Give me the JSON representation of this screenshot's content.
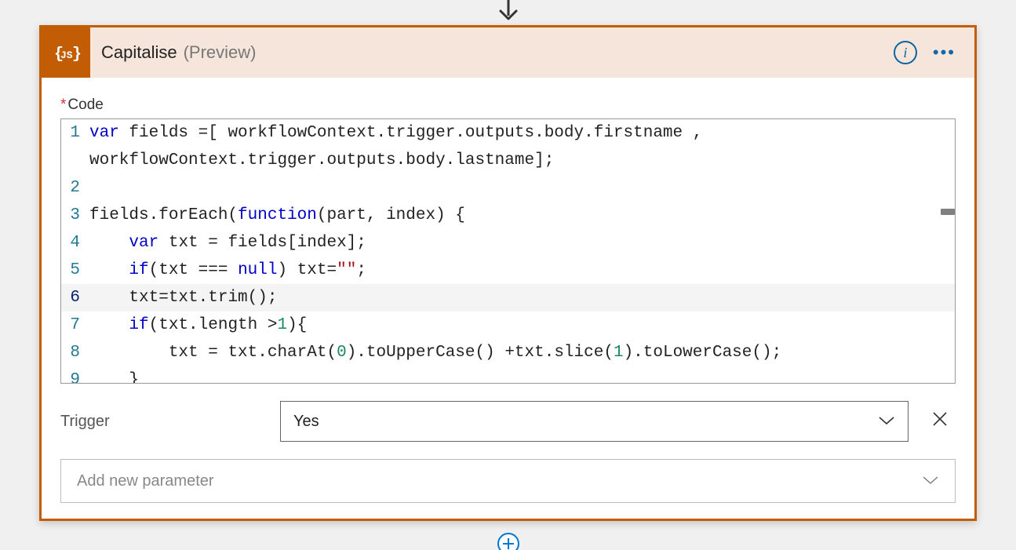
{
  "header": {
    "title": "Capitalise",
    "subtitle": "(Preview)"
  },
  "code": {
    "label": "Code",
    "lines": [
      {
        "n": "1",
        "indent": 0,
        "segs": [
          {
            "t": "var ",
            "c": "kw"
          },
          {
            "t": "fields =[ workflowContext.trigger.outputs.body.firstname ,"
          }
        ]
      },
      {
        "n": "",
        "indent": 0,
        "segs": [
          {
            "t": "workflowContext.trigger.outputs.body.lastname];"
          }
        ]
      },
      {
        "n": "2",
        "indent": 0,
        "segs": []
      },
      {
        "n": "3",
        "indent": 0,
        "segs": [
          {
            "t": "fields.forEach("
          },
          {
            "t": "function",
            "c": "kw"
          },
          {
            "t": "(part, index) {"
          }
        ]
      },
      {
        "n": "4",
        "indent": 1,
        "segs": [
          {
            "t": "var ",
            "c": "kw"
          },
          {
            "t": "txt = fields[index];"
          }
        ]
      },
      {
        "n": "5",
        "indent": 1,
        "segs": [
          {
            "t": "if",
            "c": "kw"
          },
          {
            "t": "(txt === "
          },
          {
            "t": "null",
            "c": "kw"
          },
          {
            "t": ") txt="
          },
          {
            "t": "\"\"",
            "c": "str"
          },
          {
            "t": ";"
          }
        ]
      },
      {
        "n": "6",
        "indent": 1,
        "hl": true,
        "cur": true,
        "segs": [
          {
            "t": "txt=txt.trim();"
          }
        ]
      },
      {
        "n": "7",
        "indent": 1,
        "segs": [
          {
            "t": "if",
            "c": "kw"
          },
          {
            "t": "(txt.length >"
          },
          {
            "t": "1",
            "c": "num"
          },
          {
            "t": "){"
          }
        ]
      },
      {
        "n": "8",
        "indent": 2,
        "segs": [
          {
            "t": "txt = txt.charAt("
          },
          {
            "t": "0",
            "c": "num"
          },
          {
            "t": ").toUpperCase() +txt.slice("
          },
          {
            "t": "1",
            "c": "num"
          },
          {
            "t": ").toLowerCase();"
          }
        ]
      },
      {
        "n": "9",
        "indent": 1,
        "segs": [
          {
            "t": "}"
          }
        ]
      }
    ]
  },
  "trigger": {
    "label": "Trigger",
    "value": "Yes"
  },
  "addParam": {
    "placeholder": "Add new parameter"
  }
}
